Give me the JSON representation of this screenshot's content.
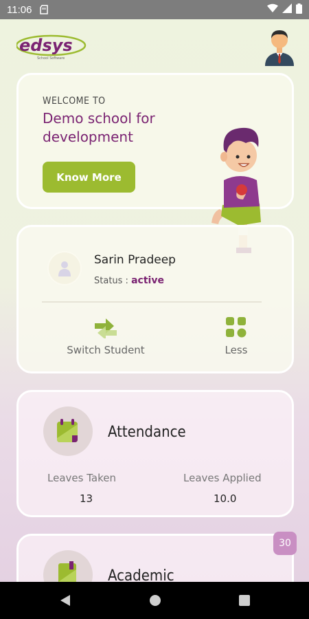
{
  "status_bar": {
    "time": "11:06"
  },
  "header": {
    "logo_text": "edsys",
    "logo_tagline": "School Software"
  },
  "welcome": {
    "label": "WELCOME TO",
    "school_name": "Demo school for development",
    "button_label": "Know More"
  },
  "student": {
    "name": "Sarin Pradeep",
    "status_label": "Status :",
    "status_value": "active",
    "actions": {
      "switch_label": "Switch Student",
      "less_label": "Less"
    }
  },
  "attendance": {
    "title": "Attendance",
    "leaves_taken_label": "Leaves Taken",
    "leaves_taken_value": "13",
    "leaves_applied_label": "Leaves Applied",
    "leaves_applied_value": "10.0"
  },
  "academic": {
    "title": "Academic",
    "badge": "30"
  },
  "colors": {
    "accent_purple": "#7a2372",
    "accent_green": "#9cbb30"
  }
}
